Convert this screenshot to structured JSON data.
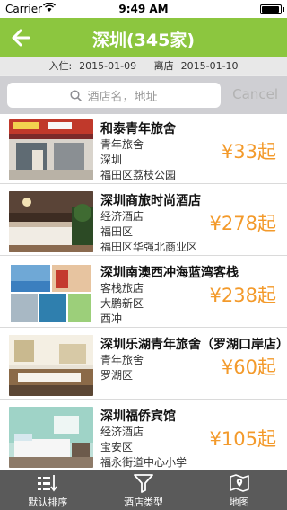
{
  "status": {
    "carrier": "Carrier",
    "time": "9:49 AM",
    "battery_level": 0.95
  },
  "nav": {
    "title": "深圳(345家)",
    "back_icon": "arrow-left-icon"
  },
  "dates": {
    "checkin_label": "入住:",
    "checkin": "2015-01-09",
    "checkout_label": "离店",
    "checkout": "2015-01-10"
  },
  "search": {
    "placeholder": "酒店名，地址",
    "cancel_label": "Cancel"
  },
  "hotels": [
    {
      "name": "和泰青年旅舍",
      "type": "青年旅舍",
      "district": "深圳",
      "address": "福田区荔枝公园",
      "price": "¥33起"
    },
    {
      "name": "深圳商旅时尚酒店",
      "type": "经济酒店",
      "district": "福田区",
      "address": "福田区华强北商业区",
      "price": "¥278起"
    },
    {
      "name": "深圳南澳西冲海蓝湾客栈",
      "type": "客栈旅店",
      "district": "大鹏新区",
      "address": "西冲",
      "price": "¥238起"
    },
    {
      "name": "深圳乐湖青年旅舍（罗湖口岸店）",
      "type": "青年旅舍",
      "district": "罗湖区",
      "address": "",
      "price": "¥60起"
    },
    {
      "name": "深圳福侨宾馆",
      "type": "经济酒店",
      "district": "宝安区",
      "address": "福永街道中心小学",
      "price": "¥105起"
    }
  ],
  "tabs": [
    {
      "label": "默认排序",
      "icon": "sort-icon"
    },
    {
      "label": "酒店类型",
      "icon": "filter-icon"
    },
    {
      "label": "地图",
      "icon": "map-icon"
    }
  ],
  "colors": {
    "accent": "#8cc63f",
    "price": "#f39a2b",
    "tabbar": "#5a5a5a"
  }
}
